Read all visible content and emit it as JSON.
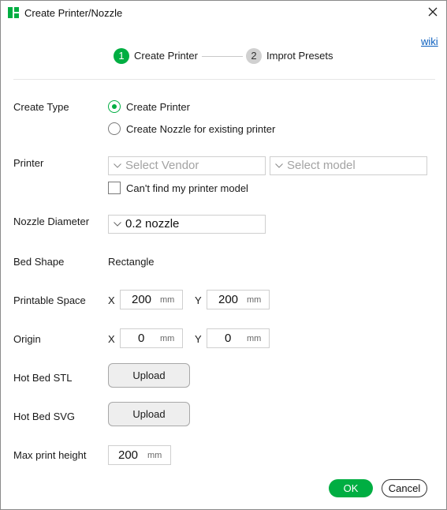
{
  "window": {
    "title": "Create Printer/Nozzle",
    "close_icon": "close-icon",
    "app_icon": "bambu-logo-icon"
  },
  "header": {
    "wiki_link": "wiki",
    "steps": [
      {
        "number": "1",
        "label": "Create Printer",
        "active": true
      },
      {
        "number": "2",
        "label": "Improt Presets",
        "active": false
      }
    ]
  },
  "form": {
    "create_type": {
      "label": "Create Type",
      "options": [
        {
          "label": "Create Printer",
          "selected": true
        },
        {
          "label": "Create Nozzle for existing printer",
          "selected": false
        }
      ]
    },
    "printer": {
      "label": "Printer",
      "vendor_placeholder": "Select Vendor",
      "model_placeholder": "Select model",
      "cant_find_label": "Can't find my printer model",
      "cant_find_checked": false
    },
    "nozzle_diameter": {
      "label": "Nozzle Diameter",
      "value": "0.2 nozzle"
    },
    "bed_shape": {
      "label": "Bed Shape",
      "value": "Rectangle"
    },
    "printable_space": {
      "label": "Printable Space",
      "x_label": "X",
      "x_value": "200",
      "y_label": "Y",
      "y_value": "200",
      "unit": "mm"
    },
    "origin": {
      "label": "Origin",
      "x_label": "X",
      "x_value": "0",
      "y_label": "Y",
      "y_value": "0",
      "unit": "mm"
    },
    "hot_bed_stl": {
      "label": "Hot Bed STL",
      "button": "Upload"
    },
    "hot_bed_svg": {
      "label": "Hot Bed SVG",
      "button": "Upload"
    },
    "max_print_height": {
      "label": "Max print height",
      "value": "200",
      "unit": "mm"
    }
  },
  "footer": {
    "ok_label": "OK",
    "cancel_label": "Cancel"
  },
  "colors": {
    "accent": "#00ae42",
    "link": "#0b5fbf",
    "placeholder": "#a3a3a3"
  }
}
